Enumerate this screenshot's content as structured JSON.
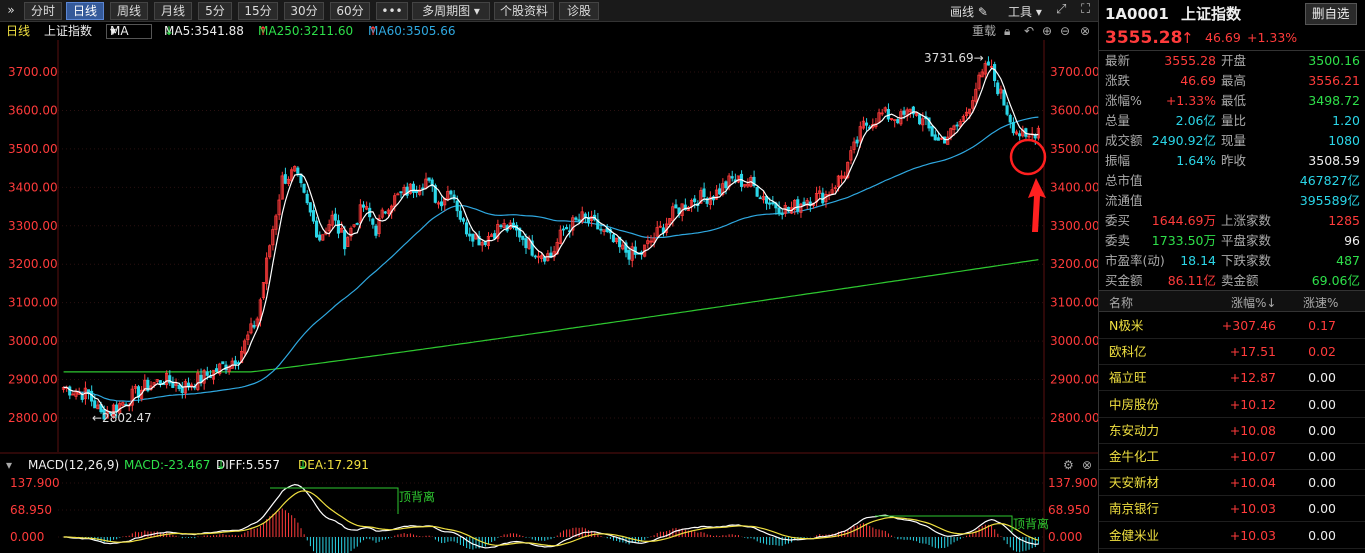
{
  "toolbar": {
    "collapse": "»",
    "tabs": [
      "分时",
      "日线",
      "周线",
      "月线",
      "5分",
      "15分",
      "30分",
      "60分",
      "•••",
      "多周期图 ▾",
      "个股资料",
      "诊股"
    ],
    "draw": "画线",
    "tools": "工具"
  },
  "info": {
    "period": "日线",
    "name": "上证指数",
    "indicator": "MA",
    "ma5": "MA5:3541.88",
    "ma250": "MA250:3211.60",
    "ma60": "MA60:3505.66",
    "reload": "重载"
  },
  "chart_data": {
    "type": "candlestick",
    "yticks": [
      "3700.00",
      "3600.00",
      "3500.00",
      "3400.00",
      "3300.00",
      "3200.00",
      "3100.00",
      "3000.00",
      "2900.00",
      "2800.00"
    ],
    "ytick_values": [
      3700,
      3600,
      3500,
      3400,
      3300,
      3200,
      3100,
      3000,
      2900,
      2800
    ],
    "high_label": "3731.69→",
    "low_label": "←2802.47",
    "ma250_color": "#2ec830",
    "ma60_color": "#2fa8e0",
    "ma5_color": "#ffffff",
    "up_color": "#ff3b3b",
    "down_color": "#2bd6e8"
  },
  "macd": {
    "title": "MACD(12,26,9)",
    "macd": "MACD:-23.467",
    "diff": "DIFF:5.557",
    "dea": "DEA:17.291",
    "yticks": [
      "137.900",
      "68.950",
      "0.000"
    ],
    "ytick_values": [
      137.9,
      68.95,
      0
    ],
    "divergence1": "顶背离",
    "divergence2": "顶背离"
  },
  "panel": {
    "code": "1A0001",
    "name": "上证指数",
    "delete_button": "删自选",
    "price": "3555.28",
    "arrow": "↑",
    "change": "46.69",
    "pct": "+1.33%",
    "quote": [
      {
        "l1": "最新",
        "v1": "3555.28",
        "c1": "red",
        "l2": "开盘",
        "v2": "3500.16",
        "c2": "green"
      },
      {
        "l1": "涨跌",
        "v1": "46.69",
        "c1": "red",
        "l2": "最高",
        "v2": "3556.21",
        "c2": "red"
      },
      {
        "l1": "涨幅%",
        "v1": "+1.33%",
        "c1": "red",
        "l2": "最低",
        "v2": "3498.72",
        "c2": "green"
      },
      {
        "l1": "总量",
        "v1": "2.06亿",
        "c1": "cyan",
        "l2": "量比",
        "v2": "1.20",
        "c2": "cyan"
      },
      {
        "l1": "成交额",
        "v1": "2490.92亿",
        "c1": "cyan",
        "l2": "现量",
        "v2": "1080",
        "c2": "cyan"
      },
      {
        "l1": "振幅",
        "v1": "1.64%",
        "c1": "cyan",
        "l2": "昨收",
        "v2": "3508.59",
        "c2": "white"
      },
      {
        "l1": "总市值",
        "v1": "",
        "c1": "cyan",
        "l2": "",
        "v2": "467827亿",
        "c2": "cyan"
      },
      {
        "l1": "流通值",
        "v1": "",
        "c1": "cyan",
        "l2": "",
        "v2": "395589亿",
        "c2": "cyan"
      },
      {
        "l1": "委买",
        "v1": "1644.69万",
        "c1": "red",
        "l2": "上涨家数",
        "v2": "1285",
        "c2": "red"
      },
      {
        "l1": "委卖",
        "v1": "1733.50万",
        "c1": "green",
        "l2": "平盘家数",
        "v2": "96",
        "c2": "white"
      },
      {
        "l1": "市盈率(动)",
        "v1": "18.14",
        "c1": "cyan",
        "l2": "下跌家数",
        "v2": "487",
        "c2": "green"
      },
      {
        "l1": "买金额",
        "v1": "86.11亿",
        "c1": "red",
        "l2": "卖金额",
        "v2": "69.06亿",
        "c2": "green"
      }
    ],
    "list_headers": [
      "名称",
      "涨幅%↓",
      "涨速%"
    ],
    "list": [
      [
        "N极米",
        "+307.46",
        "0.17"
      ],
      [
        "欧科亿",
        "+17.51",
        "0.02"
      ],
      [
        "福立旺",
        "+12.87",
        "0.00"
      ],
      [
        "中房股份",
        "+10.12",
        "0.00"
      ],
      [
        "东安动力",
        "+10.08",
        "0.00"
      ],
      [
        "金牛化工",
        "+10.07",
        "0.00"
      ],
      [
        "天安新材",
        "+10.04",
        "0.00"
      ],
      [
        "南京银行",
        "+10.03",
        "0.00"
      ],
      [
        "金健米业",
        "+10.03",
        "0.00"
      ]
    ]
  }
}
